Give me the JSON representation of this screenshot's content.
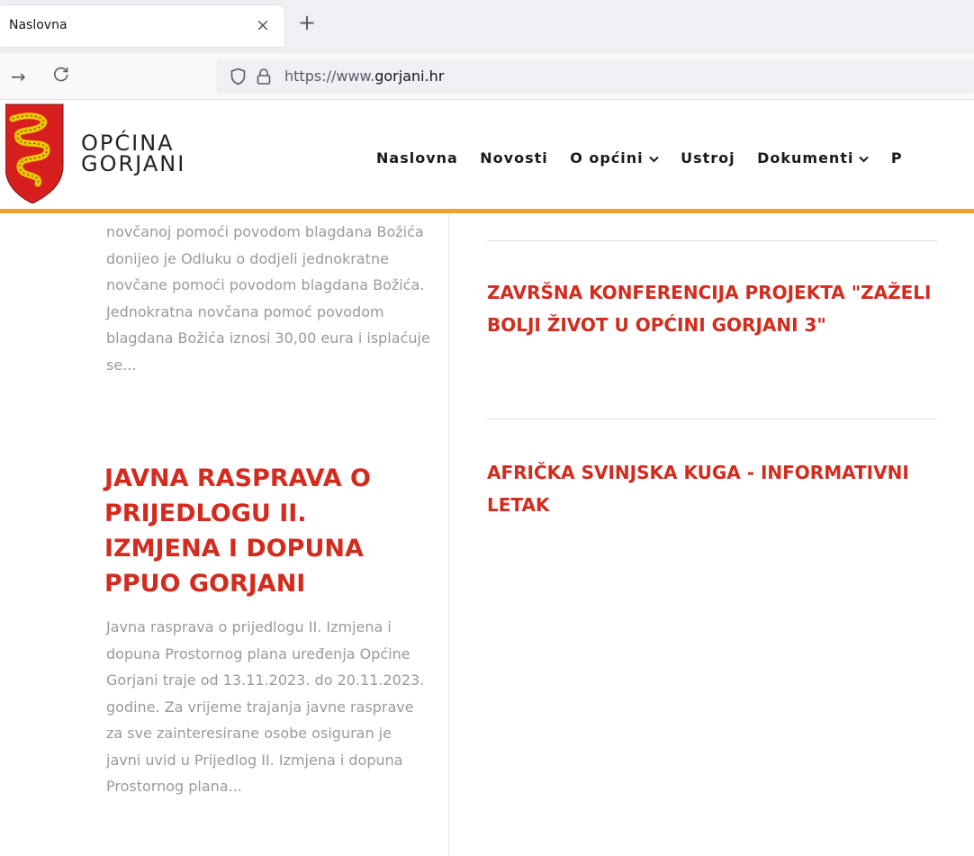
{
  "browser": {
    "tab_title": "Naslovna",
    "tab_close": "×",
    "new_tab": "+",
    "forward": "→",
    "reload": "C",
    "url_prefix": "https://www.",
    "url_host": "gorjani.hr"
  },
  "site": {
    "logo_line1": "OPĆINA",
    "logo_line2": "GORJANI",
    "accent_color": "#e9a52b",
    "title_color": "#d32b1e",
    "menu": [
      {
        "label": "Naslovna",
        "dropdown": false
      },
      {
        "label": "Novosti",
        "dropdown": false
      },
      {
        "label": "O općini",
        "dropdown": true
      },
      {
        "label": "Ustroj",
        "dropdown": false
      },
      {
        "label": "Dokumenti",
        "dropdown": true
      },
      {
        "label": "P",
        "dropdown": false
      }
    ]
  },
  "main": {
    "post1_excerpt": "novčanoj pomoći povodom blagdana Božića donijeo je Odluku o dodjeli jednokratne novčane pomoći povodom blagdana Božića. Jednokratna novčana pomoć povodom blagdana Božića iznosi 30,00 eura i isplaćuje se...",
    "post2_title": "JAVNA RASPRAVA O PRIJEDLOGU II. IZMJENA I DOPUNA PPUO GORJANI",
    "post2_excerpt": "Javna rasprava o prijedlogu II. Izmjena i dopuna Prostornog plana uređenja Općine Gorjani traje od 13.11.2023. do 20.11.2023. godine. Za vrijeme trajanja javne rasprave za sve zainteresirane osobe osiguran je javni uvid u Prijedlog II. Izmjena i dopuna Prostornog plana..."
  },
  "sidebar": {
    "items": [
      {
        "title": "ZAVRŠNA KONFERENCIJA PROJEKTA \"ZAŽELI BOLJI ŽIVOT U OPĆINI GORJANI 3\""
      },
      {
        "title": "AFRIČKA SVINJSKA KUGA - INFORMATIVNI LETAK"
      }
    ]
  }
}
